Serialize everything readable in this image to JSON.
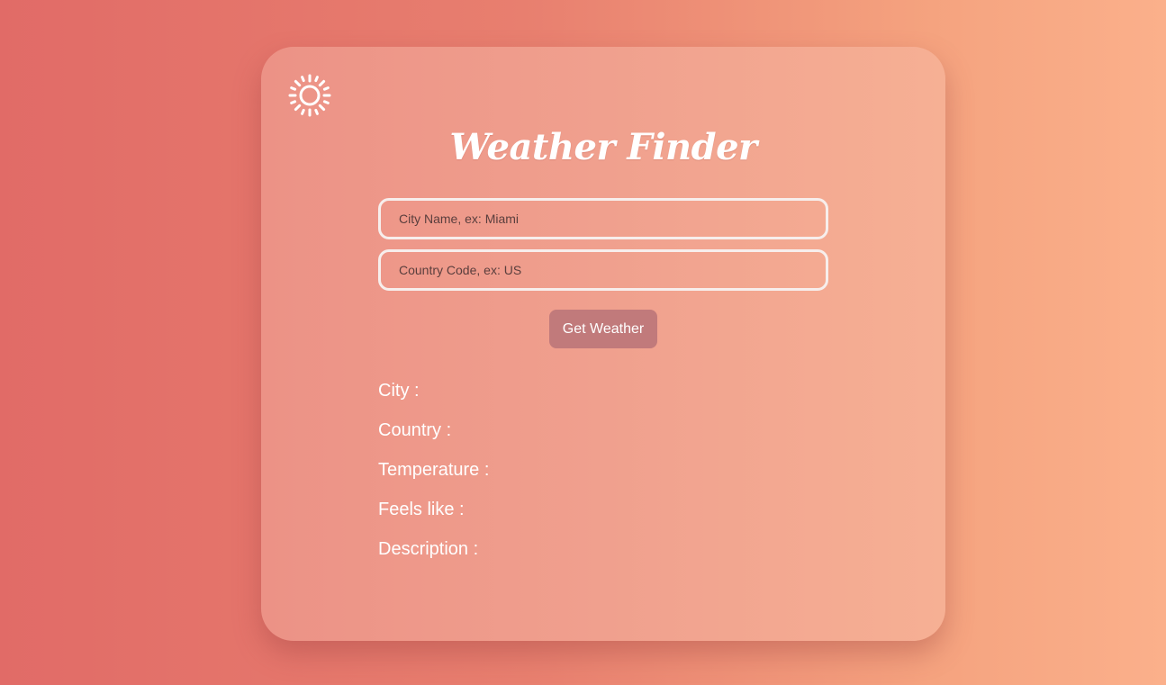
{
  "app": {
    "title": "Weather Finder",
    "icon": "sun-icon"
  },
  "form": {
    "city_placeholder": "City Name, ex: Miami",
    "country_placeholder": "Country Code, ex: US",
    "submit_label": "Get Weather"
  },
  "results": {
    "city_label": "City :",
    "country_label": "Country :",
    "temperature_label": "Temperature :",
    "feels_like_label": "Feels like :",
    "description_label": "Description :"
  },
  "colors": {
    "background_start": "#e16b67",
    "background_end": "#fbb08b",
    "button": "#c17a7b",
    "text": "#ffffff"
  }
}
